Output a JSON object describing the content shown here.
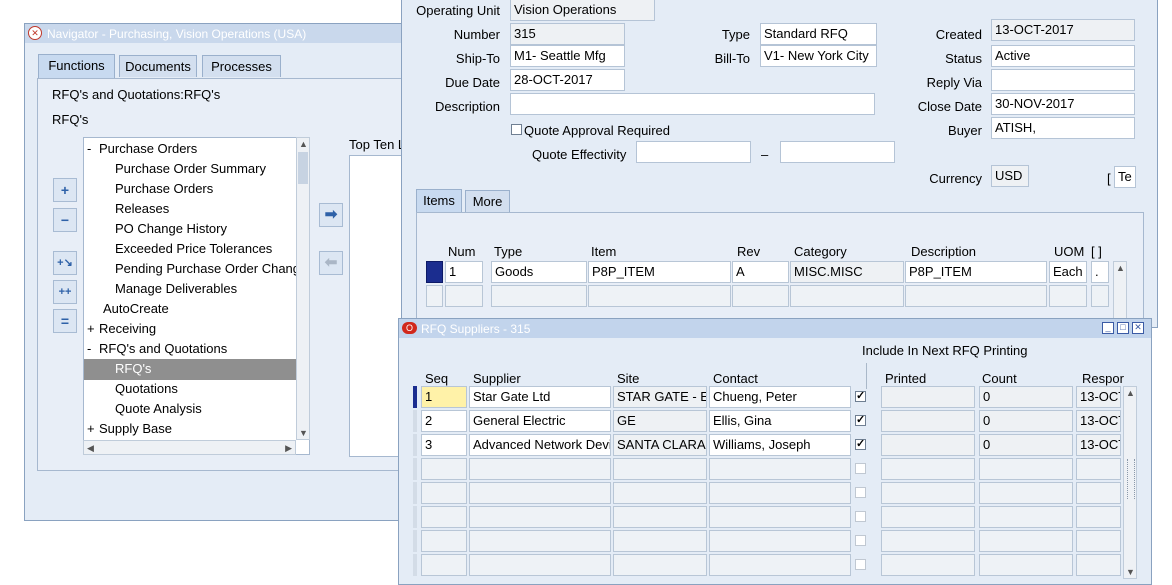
{
  "navigator": {
    "title": "Navigator - Purchasing, Vision Operations (USA)",
    "tabs": [
      {
        "label": "Functions",
        "active": true
      },
      {
        "label": "Documents",
        "active": false
      },
      {
        "label": "Processes",
        "active": false
      }
    ],
    "breadcrumb": "RFQ's and Quotations:RFQ's",
    "current": "RFQ's",
    "tree": [
      {
        "prefix": "-",
        "label": "Purchase Orders",
        "level": 0
      },
      {
        "prefix": "",
        "label": "Purchase Order Summary",
        "level": 1
      },
      {
        "prefix": "",
        "label": "Purchase Orders",
        "level": 1
      },
      {
        "prefix": "",
        "label": "Releases",
        "level": 1
      },
      {
        "prefix": "",
        "label": "PO Change History",
        "level": 1
      },
      {
        "prefix": "",
        "label": "Exceeded Price Tolerances",
        "level": 1
      },
      {
        "prefix": "",
        "label": "Pending Purchase Order Chang",
        "level": 1
      },
      {
        "prefix": "",
        "label": "Manage Deliverables",
        "level": 1
      },
      {
        "prefix": "",
        "label": "AutoCreate",
        "level": 0
      },
      {
        "prefix": "+",
        "label": "Receiving",
        "level": 0
      },
      {
        "prefix": "-",
        "label": "RFQ's and Quotations",
        "level": 0
      },
      {
        "prefix": "",
        "label": "RFQ's",
        "level": 1,
        "selected": true
      },
      {
        "prefix": "",
        "label": "Quotations",
        "level": 1
      },
      {
        "prefix": "",
        "label": "Quote Analysis",
        "level": 1
      },
      {
        "prefix": "+",
        "label": "Supply Base",
        "level": 0
      }
    ],
    "top_ten_label": "Top Ten L"
  },
  "rfq": {
    "operating_unit_label": "Operating Unit",
    "operating_unit": "Vision Operations",
    "number_label": "Number",
    "number": "315",
    "type_label": "Type",
    "type": "Standard RFQ",
    "created_label": "Created",
    "created": "13-OCT-2017",
    "ship_to_label": "Ship-To",
    "ship_to": "M1- Seattle Mfg",
    "bill_to_label": "Bill-To",
    "bill_to": "V1- New York City",
    "status_label": "Status",
    "status": "Active",
    "due_date_label": "Due Date",
    "due_date": "28-OCT-2017",
    "reply_via_label": "Reply Via",
    "reply_via": "",
    "description_label": "Description",
    "description": "",
    "close_date_label": "Close Date",
    "close_date": "30-NOV-2017",
    "quote_approval_label": "Quote Approval Required",
    "buyer_label": "Buyer",
    "buyer": "ATISH,",
    "quote_effectivity_label": "Quote Effectivity",
    "effectivity_dash": "–",
    "currency_label": "Currency",
    "currency": "USD",
    "te_bracket_open": "[",
    "te_value": "Te",
    "tabs": [
      {
        "label": "Items",
        "active": true
      },
      {
        "label": "More",
        "active": false
      }
    ],
    "items_headers": [
      "Num",
      "Type",
      "Item",
      "Rev",
      "Category",
      "Description",
      "UOM",
      "[ ]"
    ],
    "items_rows": [
      {
        "num": "1",
        "type": "Goods",
        "item": "P8P_ITEM",
        "rev": "A",
        "category": "MISC.MISC",
        "description": "P8P_ITEM",
        "uom": "Each",
        "extra": "."
      }
    ]
  },
  "suppliers": {
    "title": "RFQ Suppliers - 315",
    "include_label": "Include In Next RFQ Printing",
    "headers": {
      "seq": "Seq",
      "supplier": "Supplier",
      "site": "Site",
      "contact": "Contact",
      "printed": "Printed",
      "count": "Count",
      "response": "Respor"
    },
    "rows": [
      {
        "seq": "1",
        "supplier": "Star Gate Ltd",
        "site": "STAR GATE - E",
        "contact": "Chueng, Peter",
        "include": true,
        "printed": "",
        "count": "0",
        "response": "13-OCT"
      },
      {
        "seq": "2",
        "supplier": "General Electric",
        "site": "GE",
        "contact": "Ellis, Gina",
        "include": true,
        "printed": "",
        "count": "0",
        "response": "13-OCT"
      },
      {
        "seq": "3",
        "supplier": "Advanced Network Devic",
        "site": "SANTA CLARA",
        "contact": "Williams, Joseph",
        "include": true,
        "printed": "",
        "count": "0",
        "response": "13-OCT"
      }
    ],
    "empty_rows": 5
  },
  "colors": {
    "accent": "#1b2d8f",
    "selected_tree": "#8f8f8f",
    "titlebar": "#c9d8ec"
  }
}
